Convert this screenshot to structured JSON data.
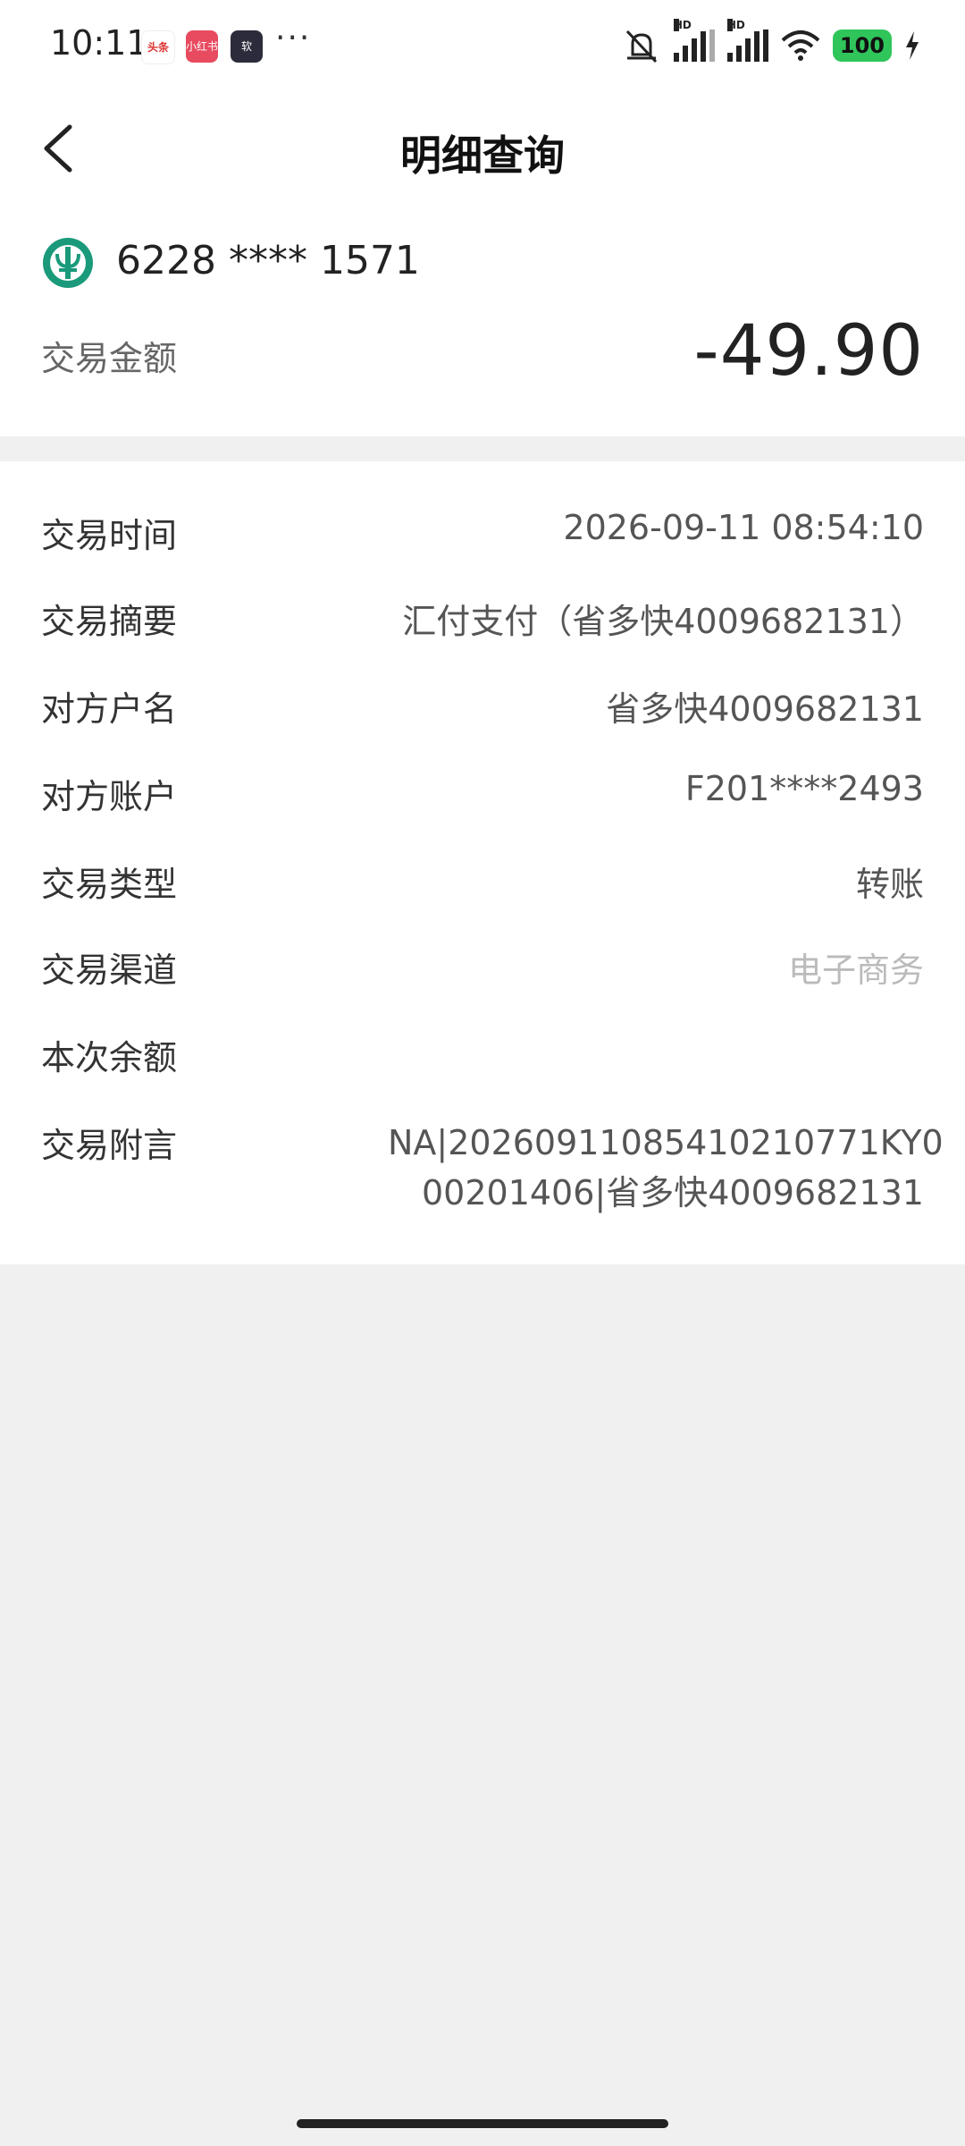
{
  "status_bar": {
    "time": "10:11",
    "apps": [
      "头条",
      "小红书",
      "软"
    ],
    "dots": "···",
    "battery": "100",
    "hd_label": "HD"
  },
  "header": {
    "title": "明细查询"
  },
  "summary": {
    "card_number": "6228 **** 1571",
    "amount_label": "交易金额",
    "amount_value": "-49.90"
  },
  "details": [
    {
      "label": "交易时间",
      "value": "2026-09-11 08:54:10"
    },
    {
      "label": "交易摘要",
      "value": "汇付支付（省多快4009682131）"
    },
    {
      "label": "对方户名",
      "value": "省多快4009682131"
    },
    {
      "label": "对方账户",
      "value": "F201****2493"
    },
    {
      "label": "交易类型",
      "value": "转账"
    },
    {
      "label": "交易渠道",
      "value": "电子商务"
    },
    {
      "label": "本次余额",
      "value": ""
    },
    {
      "label": "交易附言",
      "value_line1": "NA|20260911085410210771KY0",
      "value_line2": "00201406|省多快4009682131"
    }
  ],
  "colors": {
    "bank_green": "#1a9a7a",
    "battery_green": "#2fc55a"
  }
}
